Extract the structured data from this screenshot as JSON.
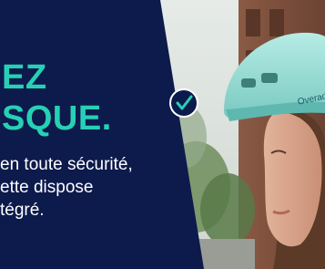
{
  "ad": {
    "headline_line1": "EZ",
    "headline_line2": "SQUE.",
    "body_line1": "en toute sécurité,",
    "body_line2": "ette dispose",
    "body_line3": "tégré.",
    "helmet_brand": "Overad"
  },
  "colors": {
    "panel": "#0c1a4c",
    "accent": "#27d0b4",
    "body_text": "#ffffff",
    "helmet": "#8fd6cf"
  },
  "icons": {
    "badge": "check-circle-icon"
  }
}
